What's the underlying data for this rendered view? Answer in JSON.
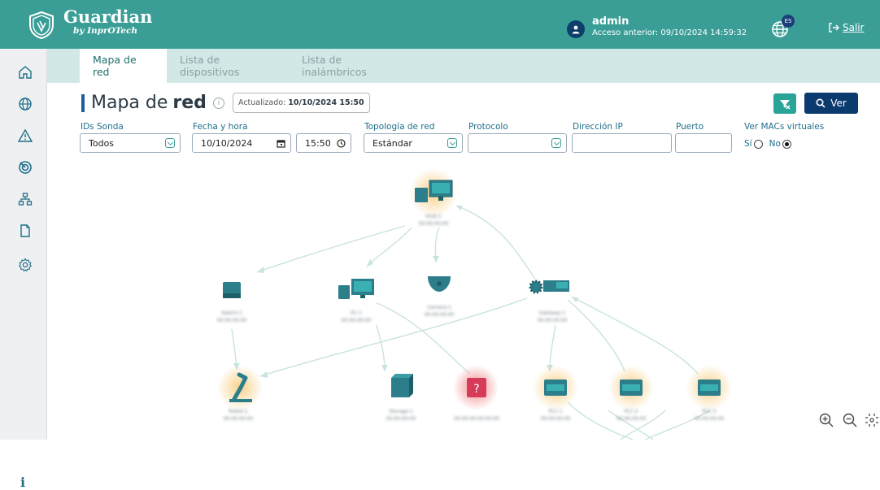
{
  "header": {
    "brand_title": "Guardian",
    "brand_subtitle": "by InprOTech",
    "user_name": "admin",
    "last_access": "Acceso anterior: 09/10/2024 14:59:32",
    "lang_badge": "ES",
    "logout_label": "Salir"
  },
  "sidebar": {
    "items": [
      "home-icon",
      "globe-icon",
      "alert-icon",
      "radar-icon",
      "network-icon",
      "document-icon",
      "settings-icon"
    ],
    "info_label": "i"
  },
  "tabs": [
    {
      "label": "Mapa de red",
      "active": true
    },
    {
      "label": "Lista de dispositivos",
      "active": false
    },
    {
      "label": "Lista de inalámbricos",
      "active": false
    }
  ],
  "page": {
    "title_light": "Mapa de",
    "title_bold": "red",
    "updated_label": "Actualizado:",
    "updated_value": "10/10/2024 15:50",
    "ver_label": "Ver"
  },
  "filters": {
    "ids_sonda_label": "IDs Sonda",
    "ids_sonda_value": "Todos",
    "fecha_label": "Fecha y hora",
    "fecha_value": "10/10/2024",
    "hora_value": "15:50",
    "topologia_label": "Topología de red",
    "topologia_value": "Estándar",
    "protocolo_label": "Protocolo",
    "protocolo_value": "",
    "ip_label": "Dirección IP",
    "ip_value": "",
    "puerto_label": "Puerto",
    "puerto_value": "",
    "macs_label": "Ver MACs virtuales",
    "si_label": "Sí",
    "no_label": "No",
    "macs_selected": "No"
  },
  "colors": {
    "header": "#3a9e97",
    "accent": "#2aa398",
    "primary": "#0b3a6e",
    "edge": "#c9e3df"
  }
}
